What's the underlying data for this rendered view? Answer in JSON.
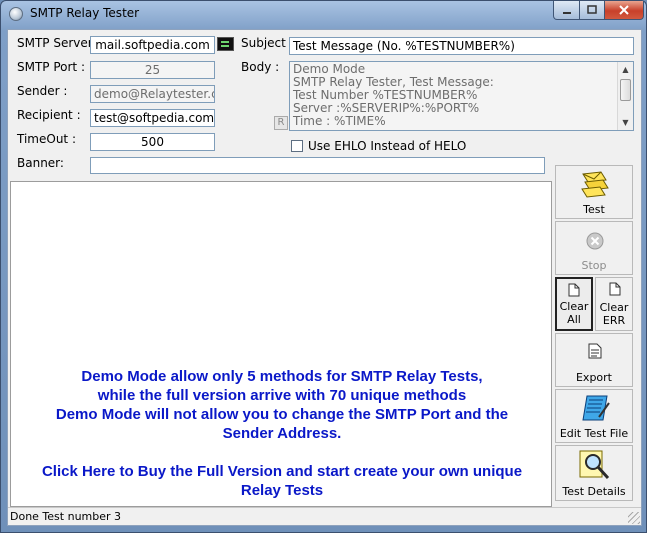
{
  "window": {
    "title": "SMTP Relay Tester"
  },
  "form": {
    "smtp_server_label": "SMTP Server :",
    "smtp_server_value": "mail.softpedia.com",
    "smtp_port_label": "SMTP Port :",
    "smtp_port_value": "25",
    "sender_label": "Sender :",
    "sender_value": "demo@Relaytester.com",
    "recipient_label": "Recipient :",
    "recipient_value": "test@softpedia.com",
    "timeout_label": "TimeOut :",
    "timeout_value": "500",
    "banner_label": "Banner:",
    "subject_label": "Subject :",
    "subject_value": "Test Message (No. %TESTNUMBER%)",
    "body_label": "Body :",
    "body_lines": [
      "Demo Mode",
      "SMTP Relay Tester, Test Message:",
      "Test Number %TESTNUMBER%",
      "Server :%SERVERIP%:%PORT%",
      "Time : %TIME%"
    ],
    "r_button": "R",
    "ehlo_label": "Use EHLO Instead  of HELO"
  },
  "log": {
    "demo_lines": [
      "Demo Mode allow only 5 methods for SMTP Relay Tests,",
      "while the full version arrive with 70 unique methods",
      "Demo Mode will not allow you to change the SMTP Port and the",
      "Sender Address."
    ],
    "buy_lines": [
      "Click Here to Buy the Full Version and start create your own unique",
      "Relay Tests"
    ]
  },
  "toolbar": {
    "test": "Test",
    "stop": "Stop",
    "clear_all": [
      "Clear",
      "All"
    ],
    "clear_err": [
      "Clear",
      "ERR"
    ],
    "export": "Export",
    "edit_test_file": "Edit Test File",
    "test_details": "Test Details"
  },
  "status": {
    "text": "Done Test number 3"
  },
  "colors": {
    "message_text": "#0a18c8"
  }
}
